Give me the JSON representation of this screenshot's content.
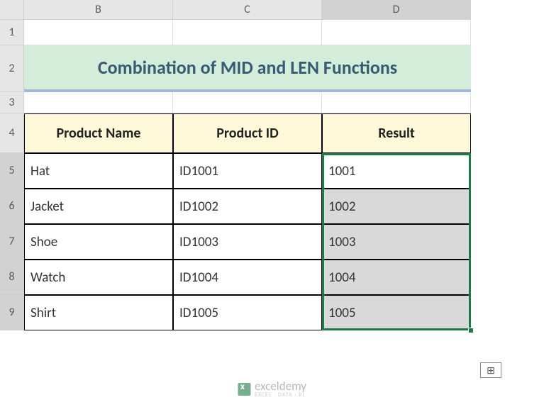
{
  "columns": [
    "B",
    "C",
    "D"
  ],
  "rows": [
    "1",
    "2",
    "3",
    "4",
    "5",
    "6",
    "7",
    "8",
    "9"
  ],
  "title": "Combination of MID and LEN Functions",
  "headers": {
    "product_name": "Product Name",
    "product_id": "Product ID",
    "result": "Result"
  },
  "data": [
    {
      "name": "Hat",
      "id": "ID1001",
      "result": "1001",
      "shaded": false
    },
    {
      "name": "Jacket",
      "id": "ID1002",
      "result": "1002",
      "shaded": true
    },
    {
      "name": "Shoe",
      "id": "ID1003",
      "result": "1003",
      "shaded": true
    },
    {
      "name": "Watch",
      "id": "ID1004",
      "result": "1004",
      "shaded": true
    },
    {
      "name": "Shirt",
      "id": "ID1005",
      "result": "1005",
      "shaded": true
    }
  ],
  "watermark": {
    "text": "exceldemy",
    "sub": "EXCEL · DATA · BI"
  },
  "chart_data": {
    "type": "table",
    "title": "Combination of MID and LEN Functions",
    "columns": [
      "Product Name",
      "Product ID",
      "Result"
    ],
    "rows": [
      [
        "Hat",
        "ID1001",
        "1001"
      ],
      [
        "Jacket",
        "ID1002",
        "1002"
      ],
      [
        "Shoe",
        "ID1003",
        "1003"
      ],
      [
        "Watch",
        "ID1004",
        "1004"
      ],
      [
        "Shirt",
        "ID1005",
        "1005"
      ]
    ]
  }
}
